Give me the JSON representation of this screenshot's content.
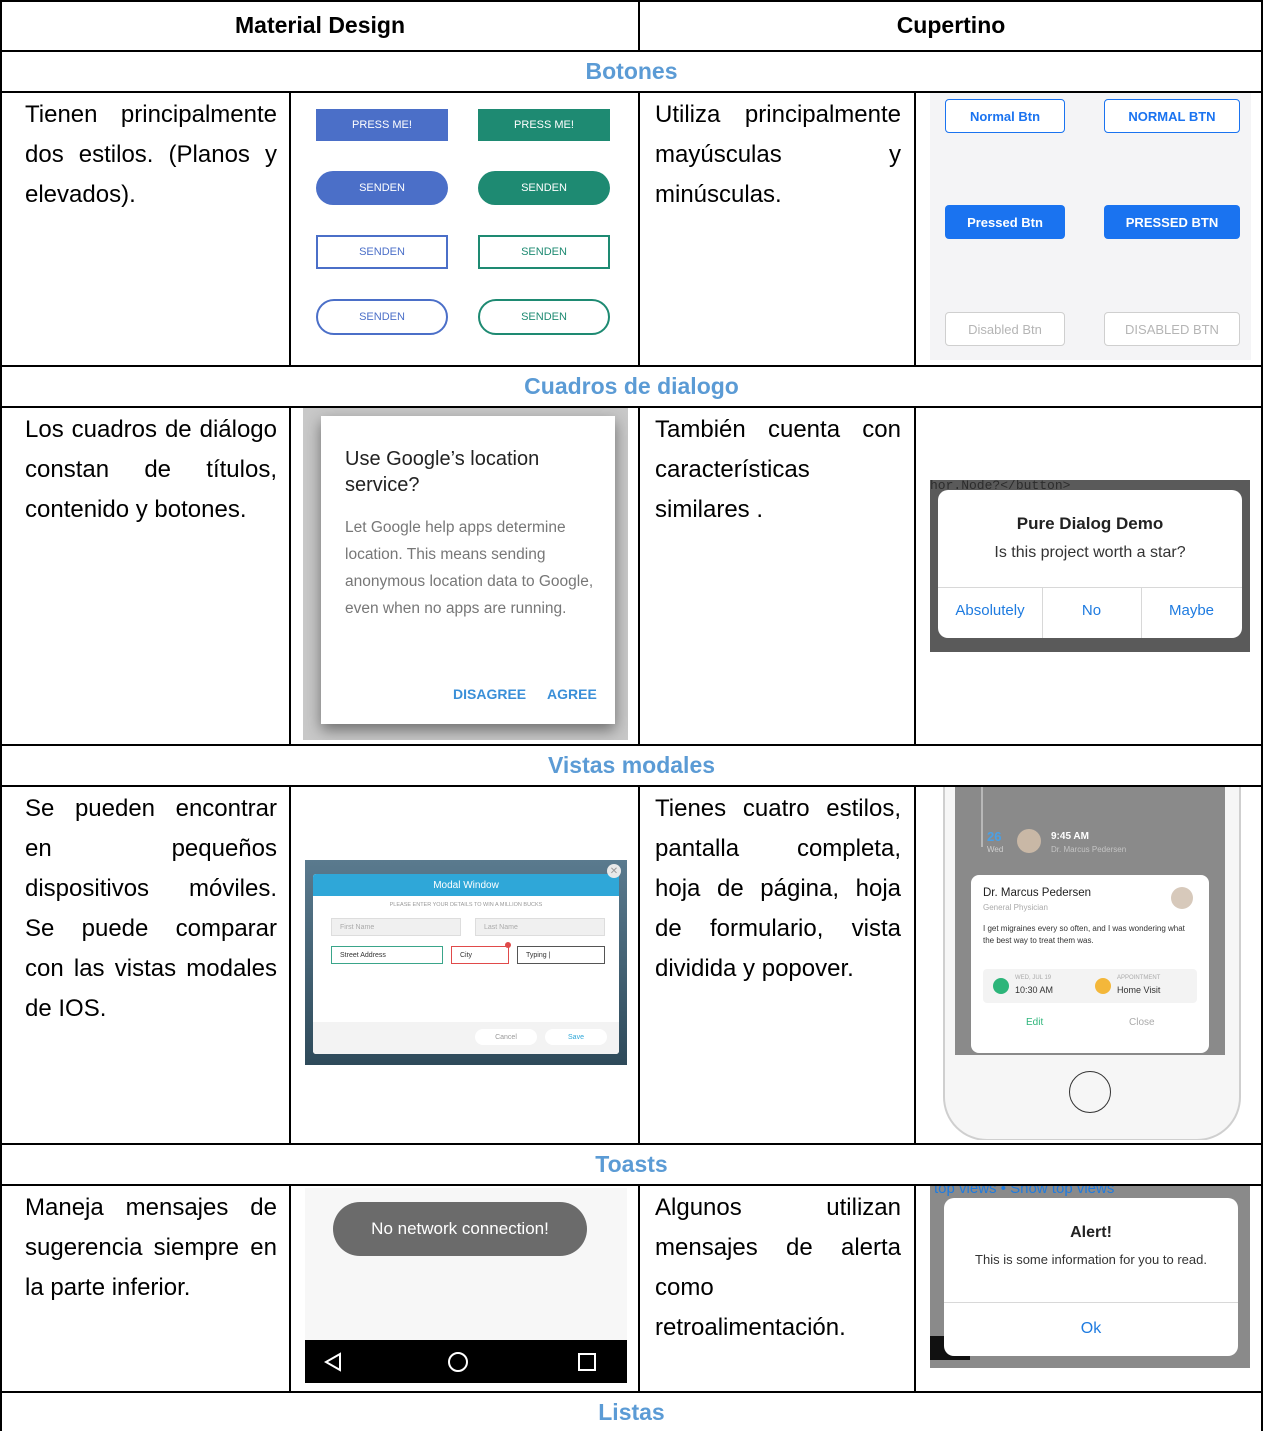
{
  "headers": {
    "material": "Material Design",
    "cupertino": "Cupertino"
  },
  "sections": [
    {
      "title": "Botones",
      "material_text": "Tienen principalmente dos estilos. (Planos y elevados).",
      "cupertino_text": "Utiliza principalmente mayúsculas y minúsculas.",
      "material_image": {
        "labels": [
          "PRESS ME!",
          "PRESS ME!",
          "SENDEN",
          "SENDEN",
          "SENDEN",
          "SENDEN",
          "SENDEN",
          "SENDEN"
        ],
        "colors": {
          "blue": "#4b6fc8",
          "teal": "#1e8a72"
        }
      },
      "cupertino_image": {
        "labels": [
          "Normal Btn",
          "NORMAL BTN",
          "Pressed Btn",
          "PRESSED BTN",
          "Disabled Btn",
          "DISABLED BTN"
        ],
        "colors": {
          "accent": "#1a73f0"
        }
      }
    },
    {
      "title": "Cuadros de dialogo",
      "material_text": "Los cuadros de diálogo constan de títulos, contenido y botones.",
      "cupertino_text": "También cuenta con características similares .",
      "material_image": {
        "title": "Use Google’s location service?",
        "body": "Let Google help apps determine location. This means sending anonymous location data to Google, even when no apps are running.",
        "disagree": "DISAGREE",
        "agree": "AGREE",
        "colors": {
          "accent": "#3a8fd8"
        }
      },
      "cupertino_image": {
        "bg_text": "hor.Node?</button>",
        "title": "Pure Dialog Demo",
        "message": "Is this project worth a star?",
        "buttons": [
          "Absolutely",
          "No",
          "Maybe"
        ],
        "colors": {
          "accent": "#1e7be0"
        }
      }
    },
    {
      "title": "Vistas modales",
      "material_text": "Se pueden encontrar en pequeños dispositivos móviles. Se puede comparar con las vistas modales de IOS.",
      "cupertino_text": "Tienes cuatro estilos, pantalla completa, hoja de página, hoja de formulario, vista dividida y popover.",
      "material_image": {
        "title": "Modal Window",
        "subtitle": "PLEASE ENTER YOUR DETAILS TO WIN A MILLION BUCKS",
        "fields": [
          "First Name",
          "Last Name",
          "Street Address",
          "City",
          "Typing |"
        ],
        "cancel": "Cancel",
        "save": "Save"
      },
      "cupertino_image": {
        "date_num": "26",
        "date_day": "Wed",
        "time": "9:45 AM",
        "doctor_small": "Dr. Marcus Pedersen",
        "name": "Dr. Marcus Pedersen",
        "role": "General Physician",
        "message": "I get migraines every so often, and I was wondering what the best way to treat them was.",
        "date_label": "WED, JUL 19",
        "date_value": "10:30 AM",
        "appt_label": "APPOINTMENT",
        "appt_value": "Home Visit",
        "edit": "Edit",
        "close": "Close"
      }
    },
    {
      "title": "Toasts",
      "material_text": "Maneja mensajes de sugerencia siempre en la parte inferior.",
      "cupertino_text": "Algunos utilizan mensajes de alerta como retroalimentación.",
      "material_image": {
        "toast": "No network connection!"
      },
      "cupertino_image": {
        "bg_text": "top views • Show top views",
        "title": "Alert!",
        "message": "This is some information for you to read.",
        "ok": "Ok"
      }
    },
    {
      "title": "Listas"
    }
  ]
}
